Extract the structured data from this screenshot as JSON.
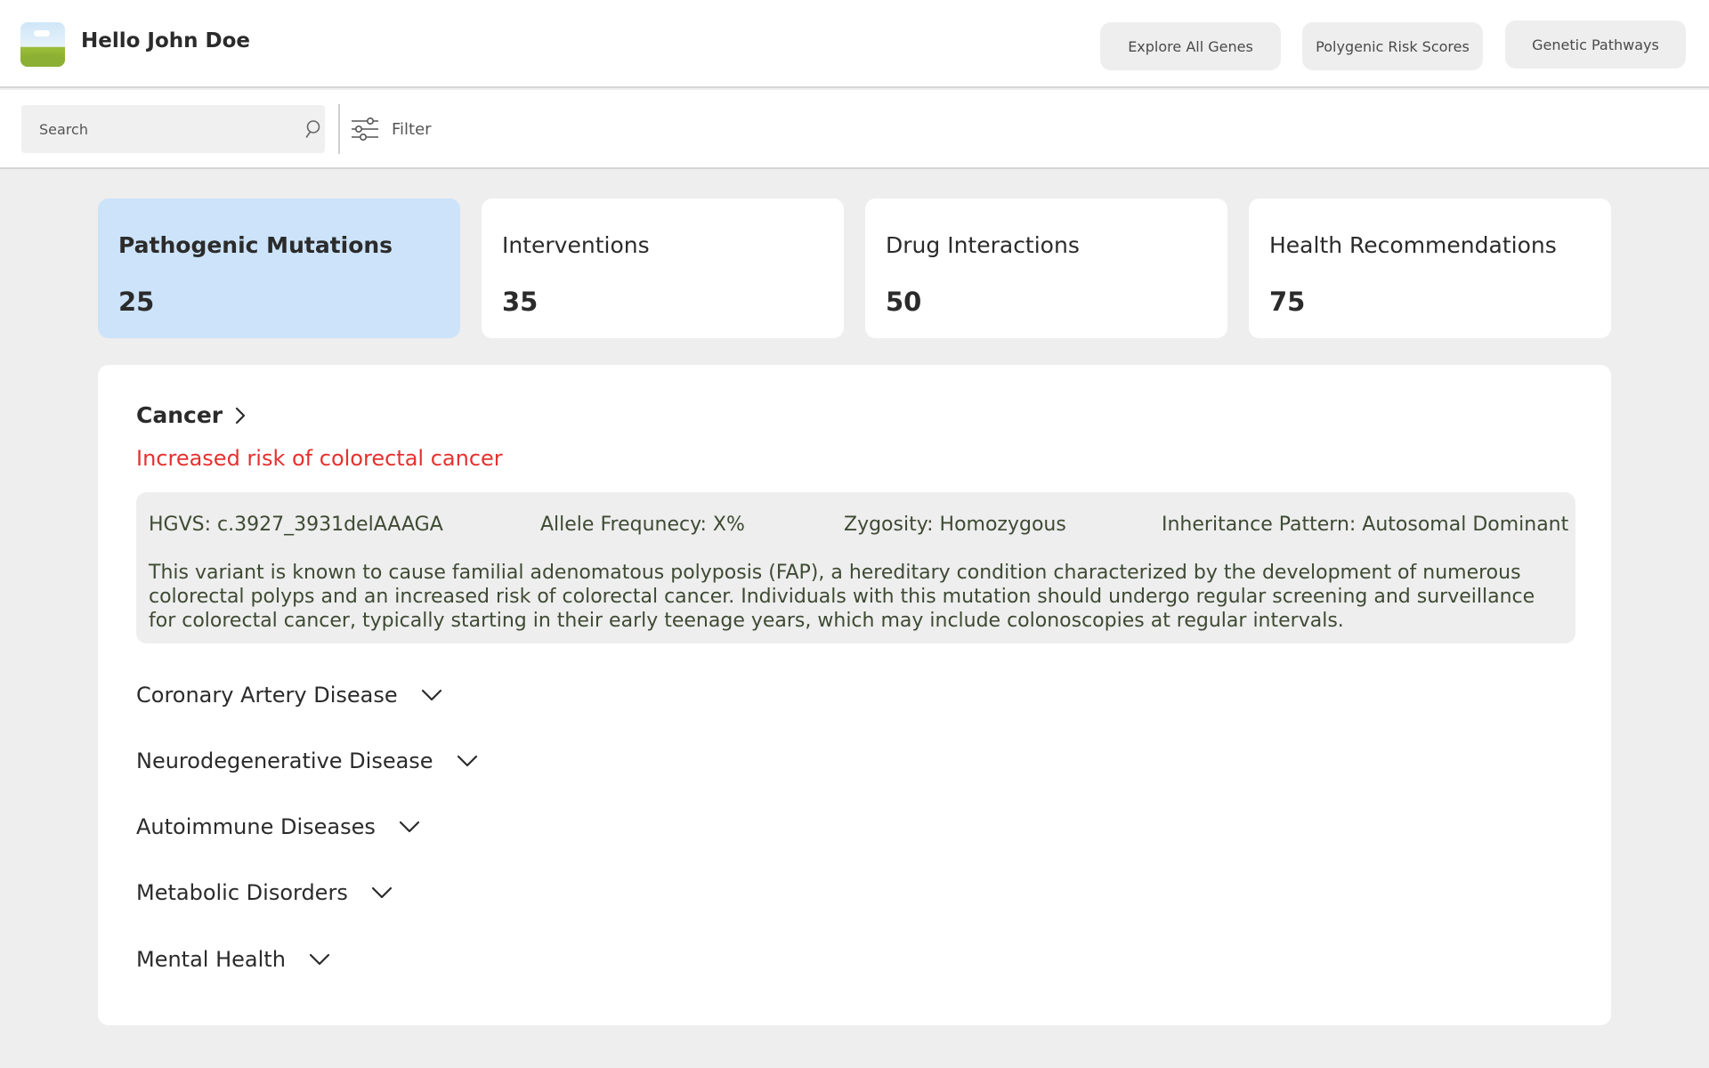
{
  "header": {
    "greeting": "Hello John Doe",
    "nav": [
      {
        "label": "Explore All Genes"
      },
      {
        "label": "Polygenic Risk Scores"
      },
      {
        "label": "Genetic Pathways"
      }
    ]
  },
  "toolbar": {
    "search_placeholder": "Search",
    "filter_label": "Filter"
  },
  "stats": [
    {
      "label": "Pathogenic Mutations",
      "value": "25",
      "active": true
    },
    {
      "label": "Interventions",
      "value": "35",
      "active": false
    },
    {
      "label": "Drug Interactions",
      "value": "50",
      "active": false
    },
    {
      "label": "Health Recommendations",
      "value": "75",
      "active": false
    }
  ],
  "panel": {
    "category": "Cancer",
    "risk": "Increased risk of colorectal cancer",
    "variant": {
      "hgvs": "HGVS: c.3927_3931delAAAGA",
      "allele_frequency": "Allele Frequnecy: X%",
      "zygosity": "Zygosity: Homozygous",
      "inheritance": "Inheritance Pattern: Autosomal Dominant",
      "description": "This variant is known to cause familial adenomatous polyposis (FAP), a hereditary condition characterized by the development of numerous colorectal polyps and an increased risk of colorectal cancer. Individuals with this mutation should undergo regular screening and surveillance for colorectal cancer, typically starting in their early teenage years, which may include colonoscopies at regular intervals."
    },
    "categories": [
      {
        "label": "Coronary Artery Disease"
      },
      {
        "label": "Neurodegenerative Disease"
      },
      {
        "label": "Autoimmune Diseases"
      },
      {
        "label": "Metabolic Disorders"
      },
      {
        "label": "Mental Health"
      }
    ]
  },
  "colors": {
    "active_card": "#cce3fa",
    "risk_text": "#e5312f",
    "variant_text": "#3e4a33"
  }
}
